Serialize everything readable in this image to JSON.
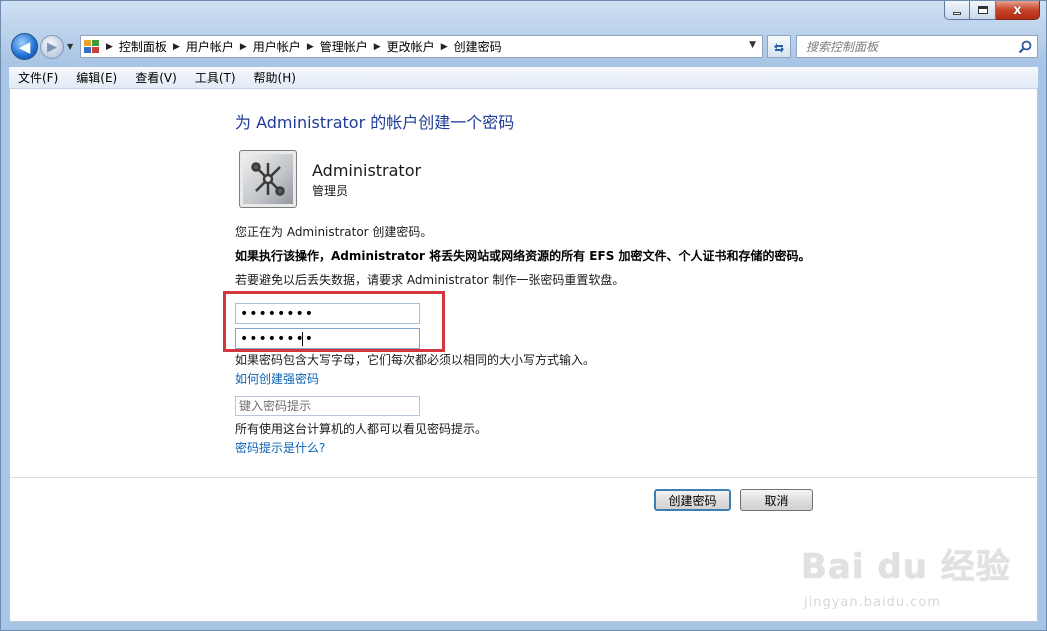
{
  "window": {
    "close_glyph": "x",
    "max_glyph": "",
    "min_glyph": ""
  },
  "nav": {
    "back_glyph": "◀",
    "forward_glyph": "▶",
    "breadcrumbs": [
      "控制面板",
      "用户帐户",
      "用户帐户",
      "管理帐户",
      "更改帐户",
      "创建密码"
    ],
    "search_placeholder": "搜索控制面板"
  },
  "menu": {
    "items": [
      "文件(F)",
      "编辑(E)",
      "查看(V)",
      "工具(T)",
      "帮助(H)"
    ]
  },
  "content": {
    "heading": "为 Administrator 的帐户创建一个密码",
    "user": {
      "name": "Administrator",
      "role": "管理员"
    },
    "info_line1": "您正在为 Administrator 创建密码。",
    "warning": "如果执行该操作，Administrator 将丢失网站或网络资源的所有 EFS 加密文件、个人证书和存储的密码。",
    "info_line3": "若要避免以后丢失数据，请要求 Administrator 制作一张密码重置软盘。",
    "new_password": "••••••••",
    "confirm_password": "••••••••",
    "case_note": "如果密码包含大写字母，它们每次都必须以相同的大小写方式输入。",
    "strong_password_link": "如何创建强密码",
    "hint_placeholder": "键入密码提示",
    "hint_note": "所有使用这台计算机的人都可以看见密码提示。",
    "hint_link": "密码提示是什么?",
    "create_button": "创建密码",
    "cancel_button": "取消"
  },
  "watermark": {
    "logo_text": "Bai du 经验",
    "url": "jingyan.baidu.com"
  },
  "colors": {
    "heading": "#1e3c96",
    "link": "#0b63b7",
    "highlight": "#d2373d"
  }
}
